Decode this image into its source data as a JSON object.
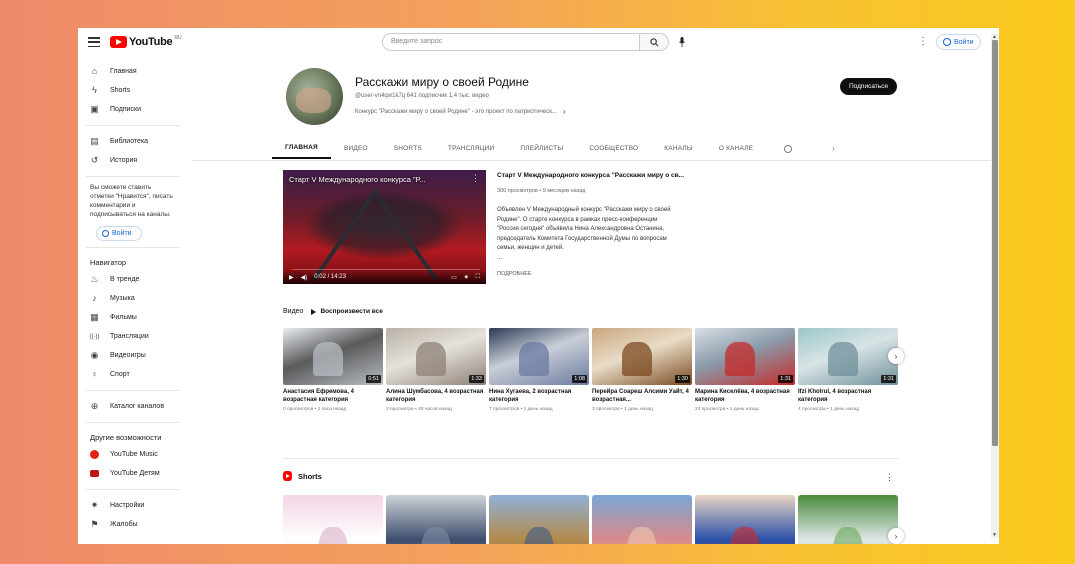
{
  "topbar": {
    "logo": "YouTube",
    "logo_cc": "RU",
    "search_placeholder": "Введите запрос",
    "signin": "Войти"
  },
  "sidebar": {
    "main_items": [
      {
        "label": "Главная",
        "icon": "home-icon"
      },
      {
        "label": "Shorts",
        "icon": "shorts-icon"
      },
      {
        "label": "Подписки",
        "icon": "subscriptions-icon"
      }
    ],
    "lib_items": [
      {
        "label": "Библиотека",
        "icon": "library-icon"
      },
      {
        "label": "История",
        "icon": "history-icon"
      }
    ],
    "note": "Вы сможете ставить отметки \"Нравится\", писать комментарии и подписываться на каналы.",
    "signin": "Войти",
    "nav_heading": "Навигатор",
    "nav_items": [
      {
        "label": "В тренде",
        "icon": "trending-icon"
      },
      {
        "label": "Музыка",
        "icon": "music-icon"
      },
      {
        "label": "Фильмы",
        "icon": "movies-icon"
      },
      {
        "label": "Трансляции",
        "icon": "live-icon"
      },
      {
        "label": "Видеоигры",
        "icon": "gaming-icon"
      },
      {
        "label": "Спорт",
        "icon": "sport-icon"
      }
    ],
    "catalog": "Каталог каналов",
    "more_heading": "Другие возможности",
    "more_items": [
      {
        "label": "YouTube Music",
        "icon": "youtube-music-icon"
      },
      {
        "label": "YouTube Детям",
        "icon": "youtube-kids-icon"
      }
    ],
    "settings_items": [
      {
        "label": "Настройки",
        "icon": "settings-icon"
      },
      {
        "label": "Жалобы",
        "icon": "flag-icon"
      }
    ]
  },
  "channel": {
    "title": "Расскажи миру о своей Родине",
    "meta": "@user-vn4qw1k7q  641 подписчик  1,4 тыс. видео",
    "description": "Конкурс \"Расскажи миру о своей Родине\" - это проект по патриотическ...",
    "subscribe": "Подписаться"
  },
  "tabs": [
    "ГЛАВНАЯ",
    "ВИДЕО",
    "SHORTS",
    "ТРАНСЛЯЦИИ",
    "ПЛЕЙЛИСТЫ",
    "СООБЩЕСТВО",
    "КАНАЛЫ",
    "О КАНАЛЕ"
  ],
  "featured": {
    "player_title": "Старт V Международного конкурса \"Р...",
    "time": "0:02 / 14:23",
    "progress": 0.02,
    "title": "Старт V Международного конкурса \"Расскажи миру о св...",
    "meta": "300 просмотров • 9 месяцев назад",
    "description": "Объявлен V Международный конкурс \"Расскажи миру о своей Родине\". О старте конкурса в рамках пресс-конференции \"Россия сегодня\" объявила Нина Александровна Останина, председатель Комитета Государственной Думы по вопросам семьи, женщин и детей.",
    "ellipsis": "...",
    "more": "ПОДРОБНЕЕ"
  },
  "videos_section": {
    "heading": "Видео",
    "play_all": "Воспроизвести все",
    "items": [
      {
        "title": "Анастасия Ефремова, 4 возрастная категория",
        "meta": "0 просмотров • 2 часа назад",
        "duration": "0:51",
        "colors": [
          "#e9eef2",
          "#b8bec4",
          "#5a5a5a"
        ]
      },
      {
        "title": "Алина Шумбасова, 4 возрастная категория",
        "meta": "3 просмотра • 20 часов назад",
        "duration": "1:33",
        "colors": [
          "#b9b0a6",
          "#8e8078",
          "#e5e2da"
        ]
      },
      {
        "title": "Нина Хугаева, 2 возрастная категория",
        "meta": "7 просмотров • 1 день назад",
        "duration": "1:08",
        "colors": [
          "#2b3a55",
          "#6b7ba0",
          "#c9ced8"
        ]
      },
      {
        "title": "Перейра Соареш Алсими Уайт, 4 возрастная...",
        "meta": "3 просмотра • 1 день назад",
        "duration": "1:30",
        "colors": [
          "#c9a77f",
          "#7b4a1f",
          "#e8dcc8"
        ]
      },
      {
        "title": "Марина Киселёва, 4 возрастная категория",
        "meta": "23 просмотра • 1 день назад",
        "duration": "1:31",
        "colors": [
          "#d9dfe6",
          "#c62a2a",
          "#8a9aa8"
        ]
      },
      {
        "title": "Ifzi Kholrul, 4 возрастная категория",
        "meta": "4 просмотра • 1 день назад",
        "duration": "1:31",
        "colors": [
          "#9cc6c8",
          "#6f8f9a",
          "#d8e4e6"
        ]
      }
    ]
  },
  "shorts_section": {
    "heading": "Shorts",
    "items": [
      {
        "colors": [
          "#f3d5e6",
          "#d8b0c8",
          "#ffffff"
        ]
      },
      {
        "colors": [
          "#cfd3d8",
          "#7e8ea5",
          "#3d4e6d"
        ]
      },
      {
        "colors": [
          "#8fb0d6",
          "#3a5a84",
          "#b48a4a"
        ]
      },
      {
        "colors": [
          "#7aa6d6",
          "#f0c8b0",
          "#d98a8a"
        ]
      },
      {
        "colors": [
          "#e8d4c4",
          "#cc2a2a",
          "#2a50a8"
        ]
      },
      {
        "colors": [
          "#4a8a3a",
          "#6aa85a",
          "#e0e8ea"
        ]
      }
    ]
  }
}
